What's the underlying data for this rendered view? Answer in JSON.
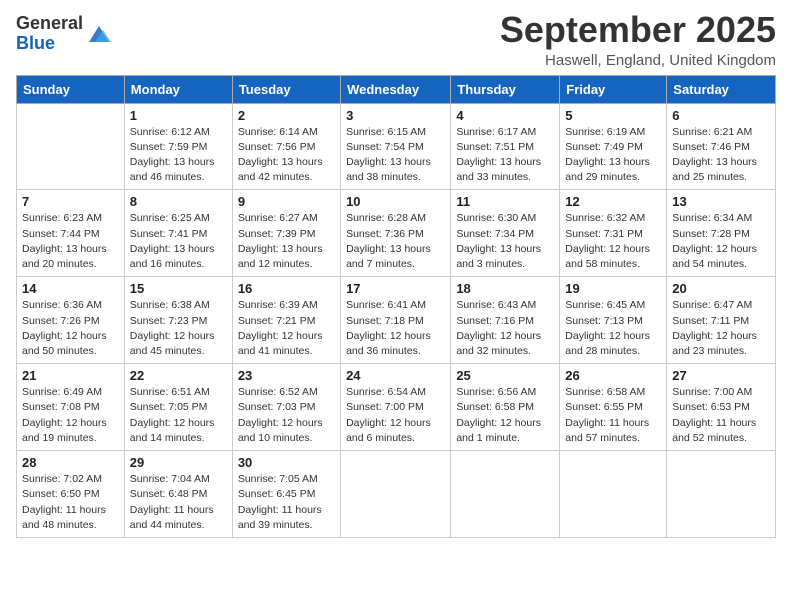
{
  "logo": {
    "general": "General",
    "blue": "Blue"
  },
  "title": "September 2025",
  "location": "Haswell, England, United Kingdom",
  "days_of_week": [
    "Sunday",
    "Monday",
    "Tuesday",
    "Wednesday",
    "Thursday",
    "Friday",
    "Saturday"
  ],
  "weeks": [
    [
      {
        "day": "",
        "sunrise": "",
        "sunset": "",
        "daylight": ""
      },
      {
        "day": "1",
        "sunrise": "Sunrise: 6:12 AM",
        "sunset": "Sunset: 7:59 PM",
        "daylight": "Daylight: 13 hours and 46 minutes."
      },
      {
        "day": "2",
        "sunrise": "Sunrise: 6:14 AM",
        "sunset": "Sunset: 7:56 PM",
        "daylight": "Daylight: 13 hours and 42 minutes."
      },
      {
        "day": "3",
        "sunrise": "Sunrise: 6:15 AM",
        "sunset": "Sunset: 7:54 PM",
        "daylight": "Daylight: 13 hours and 38 minutes."
      },
      {
        "day": "4",
        "sunrise": "Sunrise: 6:17 AM",
        "sunset": "Sunset: 7:51 PM",
        "daylight": "Daylight: 13 hours and 33 minutes."
      },
      {
        "day": "5",
        "sunrise": "Sunrise: 6:19 AM",
        "sunset": "Sunset: 7:49 PM",
        "daylight": "Daylight: 13 hours and 29 minutes."
      },
      {
        "day": "6",
        "sunrise": "Sunrise: 6:21 AM",
        "sunset": "Sunset: 7:46 PM",
        "daylight": "Daylight: 13 hours and 25 minutes."
      }
    ],
    [
      {
        "day": "7",
        "sunrise": "Sunrise: 6:23 AM",
        "sunset": "Sunset: 7:44 PM",
        "daylight": "Daylight: 13 hours and 20 minutes."
      },
      {
        "day": "8",
        "sunrise": "Sunrise: 6:25 AM",
        "sunset": "Sunset: 7:41 PM",
        "daylight": "Daylight: 13 hours and 16 minutes."
      },
      {
        "day": "9",
        "sunrise": "Sunrise: 6:27 AM",
        "sunset": "Sunset: 7:39 PM",
        "daylight": "Daylight: 13 hours and 12 minutes."
      },
      {
        "day": "10",
        "sunrise": "Sunrise: 6:28 AM",
        "sunset": "Sunset: 7:36 PM",
        "daylight": "Daylight: 13 hours and 7 minutes."
      },
      {
        "day": "11",
        "sunrise": "Sunrise: 6:30 AM",
        "sunset": "Sunset: 7:34 PM",
        "daylight": "Daylight: 13 hours and 3 minutes."
      },
      {
        "day": "12",
        "sunrise": "Sunrise: 6:32 AM",
        "sunset": "Sunset: 7:31 PM",
        "daylight": "Daylight: 12 hours and 58 minutes."
      },
      {
        "day": "13",
        "sunrise": "Sunrise: 6:34 AM",
        "sunset": "Sunset: 7:28 PM",
        "daylight": "Daylight: 12 hours and 54 minutes."
      }
    ],
    [
      {
        "day": "14",
        "sunrise": "Sunrise: 6:36 AM",
        "sunset": "Sunset: 7:26 PM",
        "daylight": "Daylight: 12 hours and 50 minutes."
      },
      {
        "day": "15",
        "sunrise": "Sunrise: 6:38 AM",
        "sunset": "Sunset: 7:23 PM",
        "daylight": "Daylight: 12 hours and 45 minutes."
      },
      {
        "day": "16",
        "sunrise": "Sunrise: 6:39 AM",
        "sunset": "Sunset: 7:21 PM",
        "daylight": "Daylight: 12 hours and 41 minutes."
      },
      {
        "day": "17",
        "sunrise": "Sunrise: 6:41 AM",
        "sunset": "Sunset: 7:18 PM",
        "daylight": "Daylight: 12 hours and 36 minutes."
      },
      {
        "day": "18",
        "sunrise": "Sunrise: 6:43 AM",
        "sunset": "Sunset: 7:16 PM",
        "daylight": "Daylight: 12 hours and 32 minutes."
      },
      {
        "day": "19",
        "sunrise": "Sunrise: 6:45 AM",
        "sunset": "Sunset: 7:13 PM",
        "daylight": "Daylight: 12 hours and 28 minutes."
      },
      {
        "day": "20",
        "sunrise": "Sunrise: 6:47 AM",
        "sunset": "Sunset: 7:11 PM",
        "daylight": "Daylight: 12 hours and 23 minutes."
      }
    ],
    [
      {
        "day": "21",
        "sunrise": "Sunrise: 6:49 AM",
        "sunset": "Sunset: 7:08 PM",
        "daylight": "Daylight: 12 hours and 19 minutes."
      },
      {
        "day": "22",
        "sunrise": "Sunrise: 6:51 AM",
        "sunset": "Sunset: 7:05 PM",
        "daylight": "Daylight: 12 hours and 14 minutes."
      },
      {
        "day": "23",
        "sunrise": "Sunrise: 6:52 AM",
        "sunset": "Sunset: 7:03 PM",
        "daylight": "Daylight: 12 hours and 10 minutes."
      },
      {
        "day": "24",
        "sunrise": "Sunrise: 6:54 AM",
        "sunset": "Sunset: 7:00 PM",
        "daylight": "Daylight: 12 hours and 6 minutes."
      },
      {
        "day": "25",
        "sunrise": "Sunrise: 6:56 AM",
        "sunset": "Sunset: 6:58 PM",
        "daylight": "Daylight: 12 hours and 1 minute."
      },
      {
        "day": "26",
        "sunrise": "Sunrise: 6:58 AM",
        "sunset": "Sunset: 6:55 PM",
        "daylight": "Daylight: 11 hours and 57 minutes."
      },
      {
        "day": "27",
        "sunrise": "Sunrise: 7:00 AM",
        "sunset": "Sunset: 6:53 PM",
        "daylight": "Daylight: 11 hours and 52 minutes."
      }
    ],
    [
      {
        "day": "28",
        "sunrise": "Sunrise: 7:02 AM",
        "sunset": "Sunset: 6:50 PM",
        "daylight": "Daylight: 11 hours and 48 minutes."
      },
      {
        "day": "29",
        "sunrise": "Sunrise: 7:04 AM",
        "sunset": "Sunset: 6:48 PM",
        "daylight": "Daylight: 11 hours and 44 minutes."
      },
      {
        "day": "30",
        "sunrise": "Sunrise: 7:05 AM",
        "sunset": "Sunset: 6:45 PM",
        "daylight": "Daylight: 11 hours and 39 minutes."
      },
      {
        "day": "",
        "sunrise": "",
        "sunset": "",
        "daylight": ""
      },
      {
        "day": "",
        "sunrise": "",
        "sunset": "",
        "daylight": ""
      },
      {
        "day": "",
        "sunrise": "",
        "sunset": "",
        "daylight": ""
      },
      {
        "day": "",
        "sunrise": "",
        "sunset": "",
        "daylight": ""
      }
    ]
  ]
}
